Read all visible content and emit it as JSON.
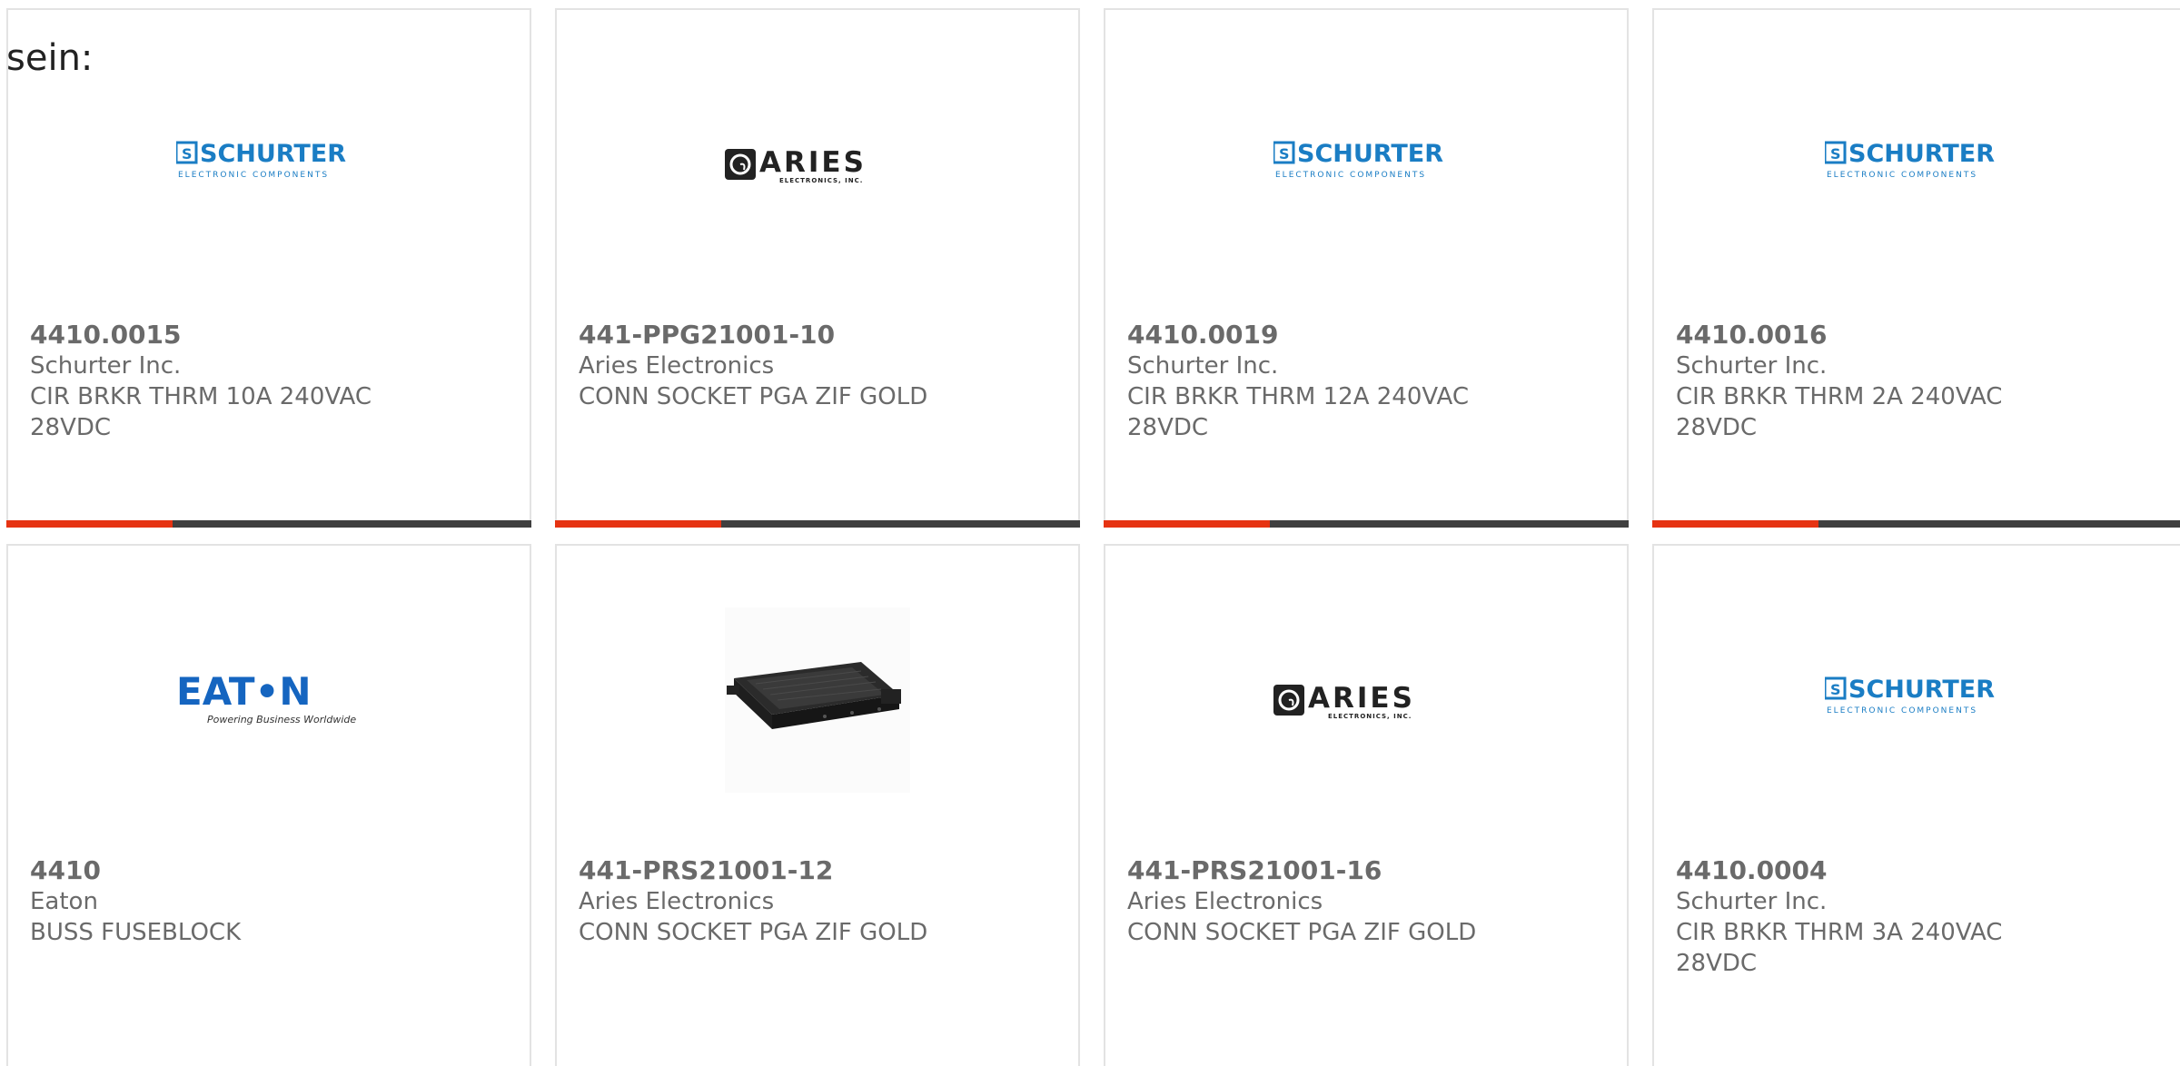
{
  "intro_text": "sein:",
  "logos": {
    "schurter_name": "SCHURTER",
    "schurter_tagline": "ELECTRONIC COMPONENTS",
    "aries_name": "ARIES",
    "aries_tagline": "ELECTRONICS, INC.",
    "eaton_name": "EAT•N",
    "eaton_tagline": "Powering Business Worldwide"
  },
  "accent_colors": {
    "schurter_blue": "#1a7dc4",
    "eaton_blue": "#1565c0",
    "accent_red": "#e63312",
    "bar_dark": "#3f3f3f"
  },
  "products": [
    {
      "part": "4410.0015",
      "mfr": "Schurter Inc.",
      "desc": "CIR BRKR THRM 10A 240VAC 28VDC",
      "image": "schurter-logo"
    },
    {
      "part": "441-PPG21001-10",
      "mfr": "Aries Electronics",
      "desc": "CONN SOCKET PGA ZIF GOLD",
      "image": "aries-logo"
    },
    {
      "part": "4410.0019",
      "mfr": "Schurter Inc.",
      "desc": "CIR BRKR THRM 12A 240VAC 28VDC",
      "image": "schurter-logo"
    },
    {
      "part": "4410.0016",
      "mfr": "Schurter Inc.",
      "desc": "CIR BRKR THRM 2A 240VAC 28VDC",
      "image": "schurter-logo"
    },
    {
      "part": "4410",
      "mfr": "Eaton",
      "desc": "BUSS FUSEBLOCK",
      "image": "eaton-logo"
    },
    {
      "part": "441-PRS21001-12",
      "mfr": "Aries Electronics",
      "desc": "CONN SOCKET PGA ZIF GOLD",
      "image": "zif-socket-photo"
    },
    {
      "part": "441-PRS21001-16",
      "mfr": "Aries Electronics",
      "desc": "CONN SOCKET PGA ZIF GOLD",
      "image": "aries-logo"
    },
    {
      "part": "4410.0004",
      "mfr": "Schurter Inc.",
      "desc": "CIR BRKR THRM 3A 240VAC 28VDC",
      "image": "schurter-logo"
    }
  ]
}
